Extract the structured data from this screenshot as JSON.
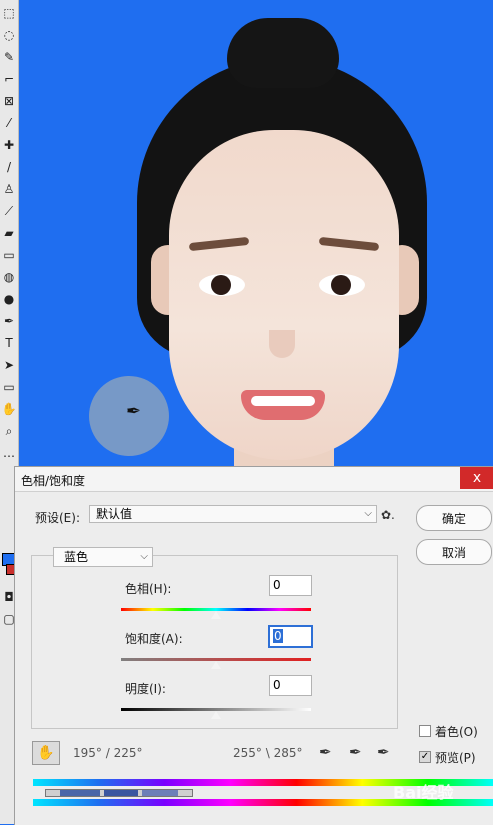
{
  "dialog": {
    "title": "色相/饱和度",
    "close_label": "x",
    "preset_label": "预设(E):",
    "preset_value": "默认值",
    "ok_label": "确定",
    "cancel_label": "取消",
    "channel_value": "蓝色",
    "hue_label": "色相(H):",
    "hue_value": "0",
    "saturation_label": "饱和度(A):",
    "saturation_value": "0",
    "lightness_label": "明度(I):",
    "lightness_value": "0",
    "range_left": "195° / 225°",
    "range_right": "255° \\ 285°",
    "colorize_label": "着色(O)",
    "colorize_checked": false,
    "preview_label": "预览(P)",
    "preview_checked": true
  },
  "watermark": "Bai经验",
  "icons": {
    "gear": "gear-icon",
    "hand": "hand-icon",
    "eyedropper": "eyedropper-icon"
  },
  "colors": {
    "background": "#1f6ef0",
    "highlight": "#2d6fd6"
  }
}
